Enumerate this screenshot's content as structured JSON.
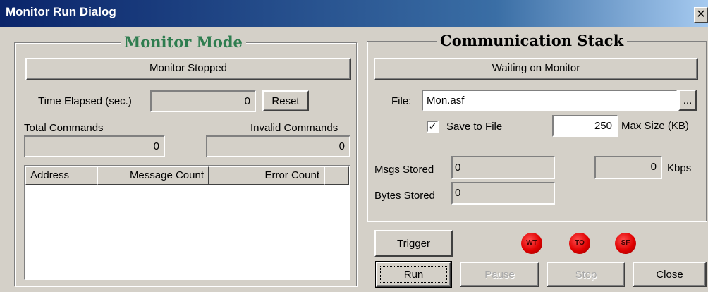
{
  "window": {
    "title": "Monitor Run Dialog",
    "close_glyph": "✕"
  },
  "monitor_mode": {
    "title": "Monitor Mode",
    "status": "Monitor Stopped",
    "time_elapsed_label": "Time Elapsed (sec.)",
    "time_elapsed_value": "0",
    "reset_label": "Reset",
    "total_commands_label": "Total Commands",
    "total_commands_value": "0",
    "invalid_commands_label": "Invalid Commands",
    "invalid_commands_value": "0",
    "table": {
      "columns": [
        "Address",
        "Message Count",
        "Error Count"
      ],
      "rows": []
    }
  },
  "comm_stack": {
    "title": "Communication Stack",
    "status": "Waiting on Monitor",
    "file_label": "File:",
    "file_value": "Mon.asf",
    "browse_label": "...",
    "save_to_file_label": "Save to File",
    "save_to_file_checked": true,
    "max_size_value": "250",
    "max_size_label": "Max Size (KB)",
    "msgs_stored_label": "Msgs Stored",
    "msgs_stored_value": "0",
    "kbps_value": "0",
    "kbps_label": "Kbps",
    "bytes_stored_label": "Bytes Stored",
    "bytes_stored_value": "0"
  },
  "controls": {
    "trigger_label": "Trigger",
    "run_label": "Run",
    "pause_label": "Pause",
    "stop_label": "Stop",
    "close_label": "Close",
    "leds": [
      "WT",
      "TO",
      "SF"
    ]
  },
  "colors": {
    "group_title_green": "#2e7d4f",
    "led_red": "#e00000"
  }
}
